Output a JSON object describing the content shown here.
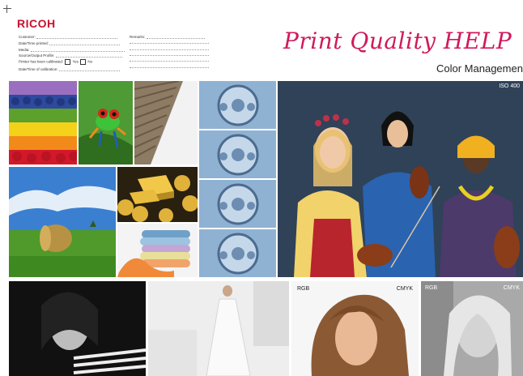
{
  "brand": {
    "logo_text": "RICOH"
  },
  "form": {
    "customer": "Customer:",
    "date_printed": "Date/Time printed:",
    "media": "Media:",
    "source_profile": "Source/Output Profile:",
    "calibrated": "Printer has been calibrated:",
    "yes": "Yes",
    "no": "No",
    "date_calibration": "Date/Time of calibration:",
    "remarks": "Remarks:"
  },
  "header": {
    "title": "Print Quality HELP",
    "subtitle": "Color Management"
  },
  "labels": {
    "iso": "ISO 400",
    "rgb_1": "RGB",
    "cmyk_1": "CMYK",
    "rgb_2": "RGB",
    "cmyk_2": "CMYK"
  },
  "colors": {
    "brand_red": "#c8102e",
    "title_pink": "#d11a5a"
  }
}
